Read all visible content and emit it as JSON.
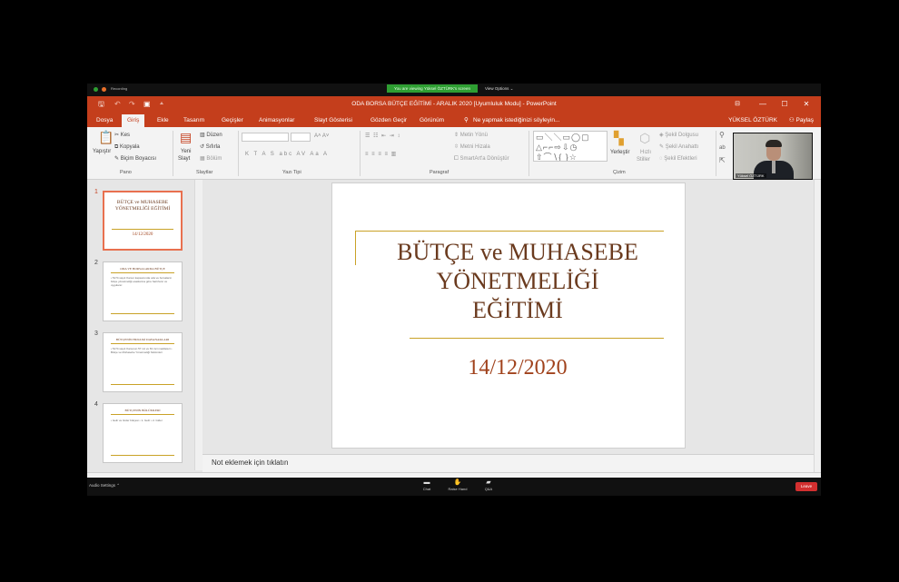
{
  "zoom": {
    "share_banner": "You are viewing Yüksel ÖZTÜRK's screen",
    "view_options": "View Options ⌄",
    "recording_label": "Recording",
    "audio_label": "Audio Settings ⌃",
    "controls": [
      {
        "icon": "chat-icon",
        "glyph": "▬",
        "label": "Chat"
      },
      {
        "icon": "raise-hand-icon",
        "glyph": "✋",
        "label": "Raise Hand"
      },
      {
        "icon": "qa-icon",
        "glyph": "▰",
        "label": "Q&A"
      }
    ],
    "leave_label": "Leave",
    "colors": {
      "banner": "#2e9e32",
      "leave": "#d32f2f"
    }
  },
  "window": {
    "title": "ODA BORSA BÜTÇE EĞİTİMİ - ARALIK 2020 [Uyumluluk Modu] - PowerPoint",
    "minimize": "—",
    "maximize": "☐",
    "close": "✕",
    "accent": "#c43e1c"
  },
  "tabs": [
    "Dosya",
    "Giriş",
    "Ekle",
    "Tasarım",
    "Geçişler",
    "Animasyonlar",
    "Slayt Gösterisi",
    "Gözden Geçir",
    "Görünüm"
  ],
  "tell_me": "Ne yapmak istediğinizi söyleyin...",
  "user_name": "YÜKSEL ÖZTÜRK",
  "share_label": "Paylaş",
  "ribbon": {
    "paste": "Yapıştır",
    "cut": "Kes",
    "copy": "Kopyala",
    "format_painter": "Biçim Boyacısı",
    "new_slide_1": "Yeni",
    "new_slide_2": "Slayt",
    "layout": "Düzen",
    "reset": "Sıfırla",
    "section": "Bölüm",
    "text_direction": "Metin Yönü",
    "align_text": "Metni Hizala",
    "smartart": "SmartArt'a Dönüştür",
    "arrange": "Yerleştir",
    "quick_styles_1": "Hızlı",
    "quick_styles_2": "Stiller",
    "shape_fill": "Şekil Dolgusu",
    "shape_outline": "Şekil Anahattı",
    "shape_effects": "Şekil Efektleri",
    "groups": {
      "clipboard": "Pano",
      "slides": "Slaytlar",
      "font": "Yazı Tipi",
      "paragraph": "Paragraf",
      "drawing": "Çizim"
    },
    "webcam_name": "Yüksel ÖZTÜRK"
  },
  "thumbnails": [
    {
      "num": "1",
      "title": "BÜTÇE ve MUHASEBE YÖNETMELİĞİ EĞİTİMİ",
      "date": "14/12/2020",
      "body": ""
    },
    {
      "num": "2",
      "title": "ODA VE BORSALARDA BÜTÇE",
      "body": "• 5174 sayılı Kanun kapsamında oda ve borsaların bütçe yönetmeliği esaslarına göre hazırlanır ve uygulanır."
    },
    {
      "num": "3",
      "title": "BÜTÇENİN HUKUKİ DAYANAKLARI",
      "body": "• 5174 sayılı Kanunun 57 nci ve 81 inci maddeleri • Bütçe ve Muhasebe Yönetmeliği hükümleri"
    },
    {
      "num": "4",
      "title": "BÜTÇENİN BÖLÜMLERİ",
      "body": "• Gelir ve Gider bütçesi • 1- Gelir • 2- Gider"
    }
  ],
  "slide": {
    "title_lines": [
      "BÜTÇE ve MUHASEBE",
      "YÖNETMELİĞİ",
      "EĞİTİMİ"
    ],
    "date": "14/12/2020",
    "title_color": "#6a3a1e",
    "date_color": "#a0421c",
    "rule_color": "#c9a227"
  },
  "notes_placeholder": "Not eklemek için tıklatın"
}
